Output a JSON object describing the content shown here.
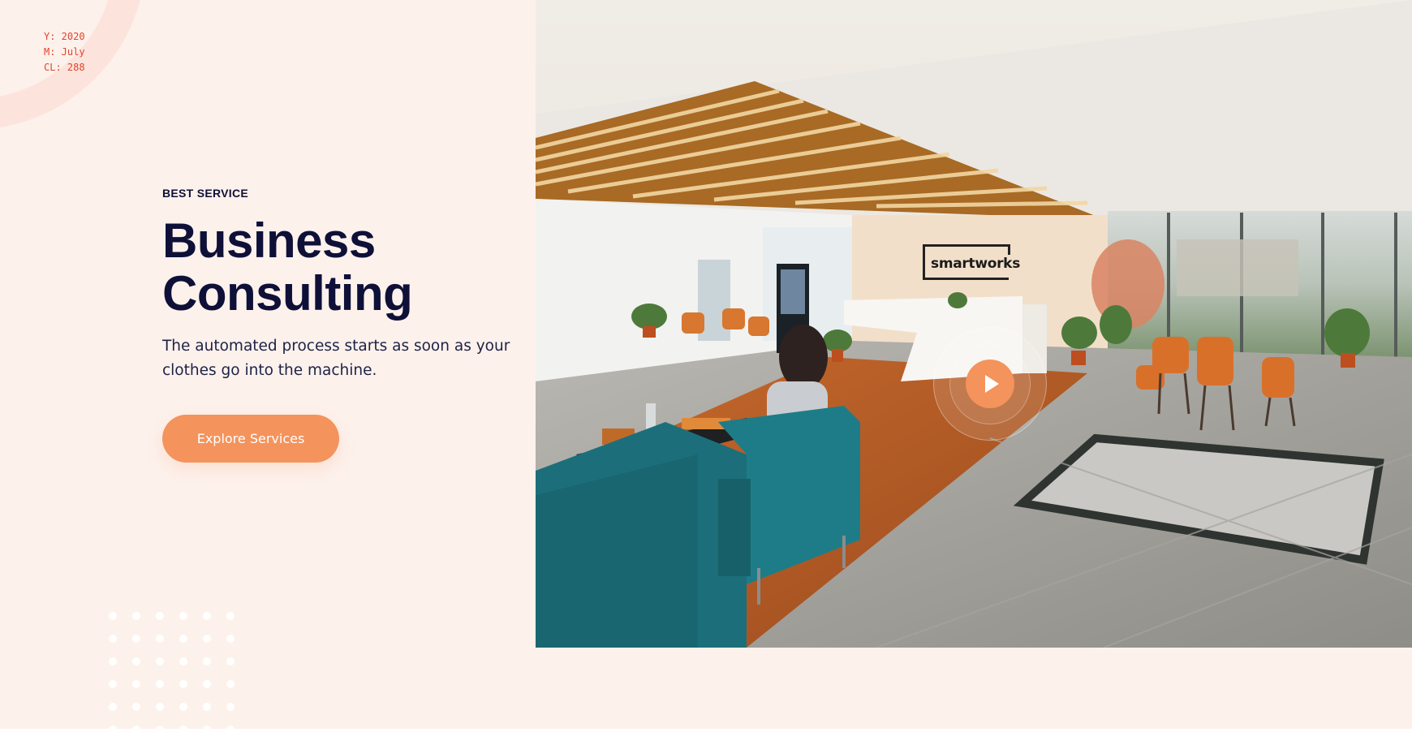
{
  "meta_overlay": {
    "year": "Y: 2020",
    "month": "M: July",
    "cl": "CL: 288"
  },
  "hero": {
    "eyebrow": "BEST SERVICE",
    "title_line1": "Business",
    "title_line2": "Consulting",
    "description": "The automated process starts as soon as your clothes go into the machine.",
    "cta_label": "Explore Services"
  },
  "photo": {
    "sign_text": "smartworks"
  },
  "icons": {
    "play": "play-icon",
    "dots": "dot-pattern-decoration",
    "ring": "ring-decoration"
  },
  "colors": {
    "background": "#fdf1ec",
    "accent": "#f4935c",
    "heading": "#0e1038",
    "meta": "#e0452b"
  }
}
